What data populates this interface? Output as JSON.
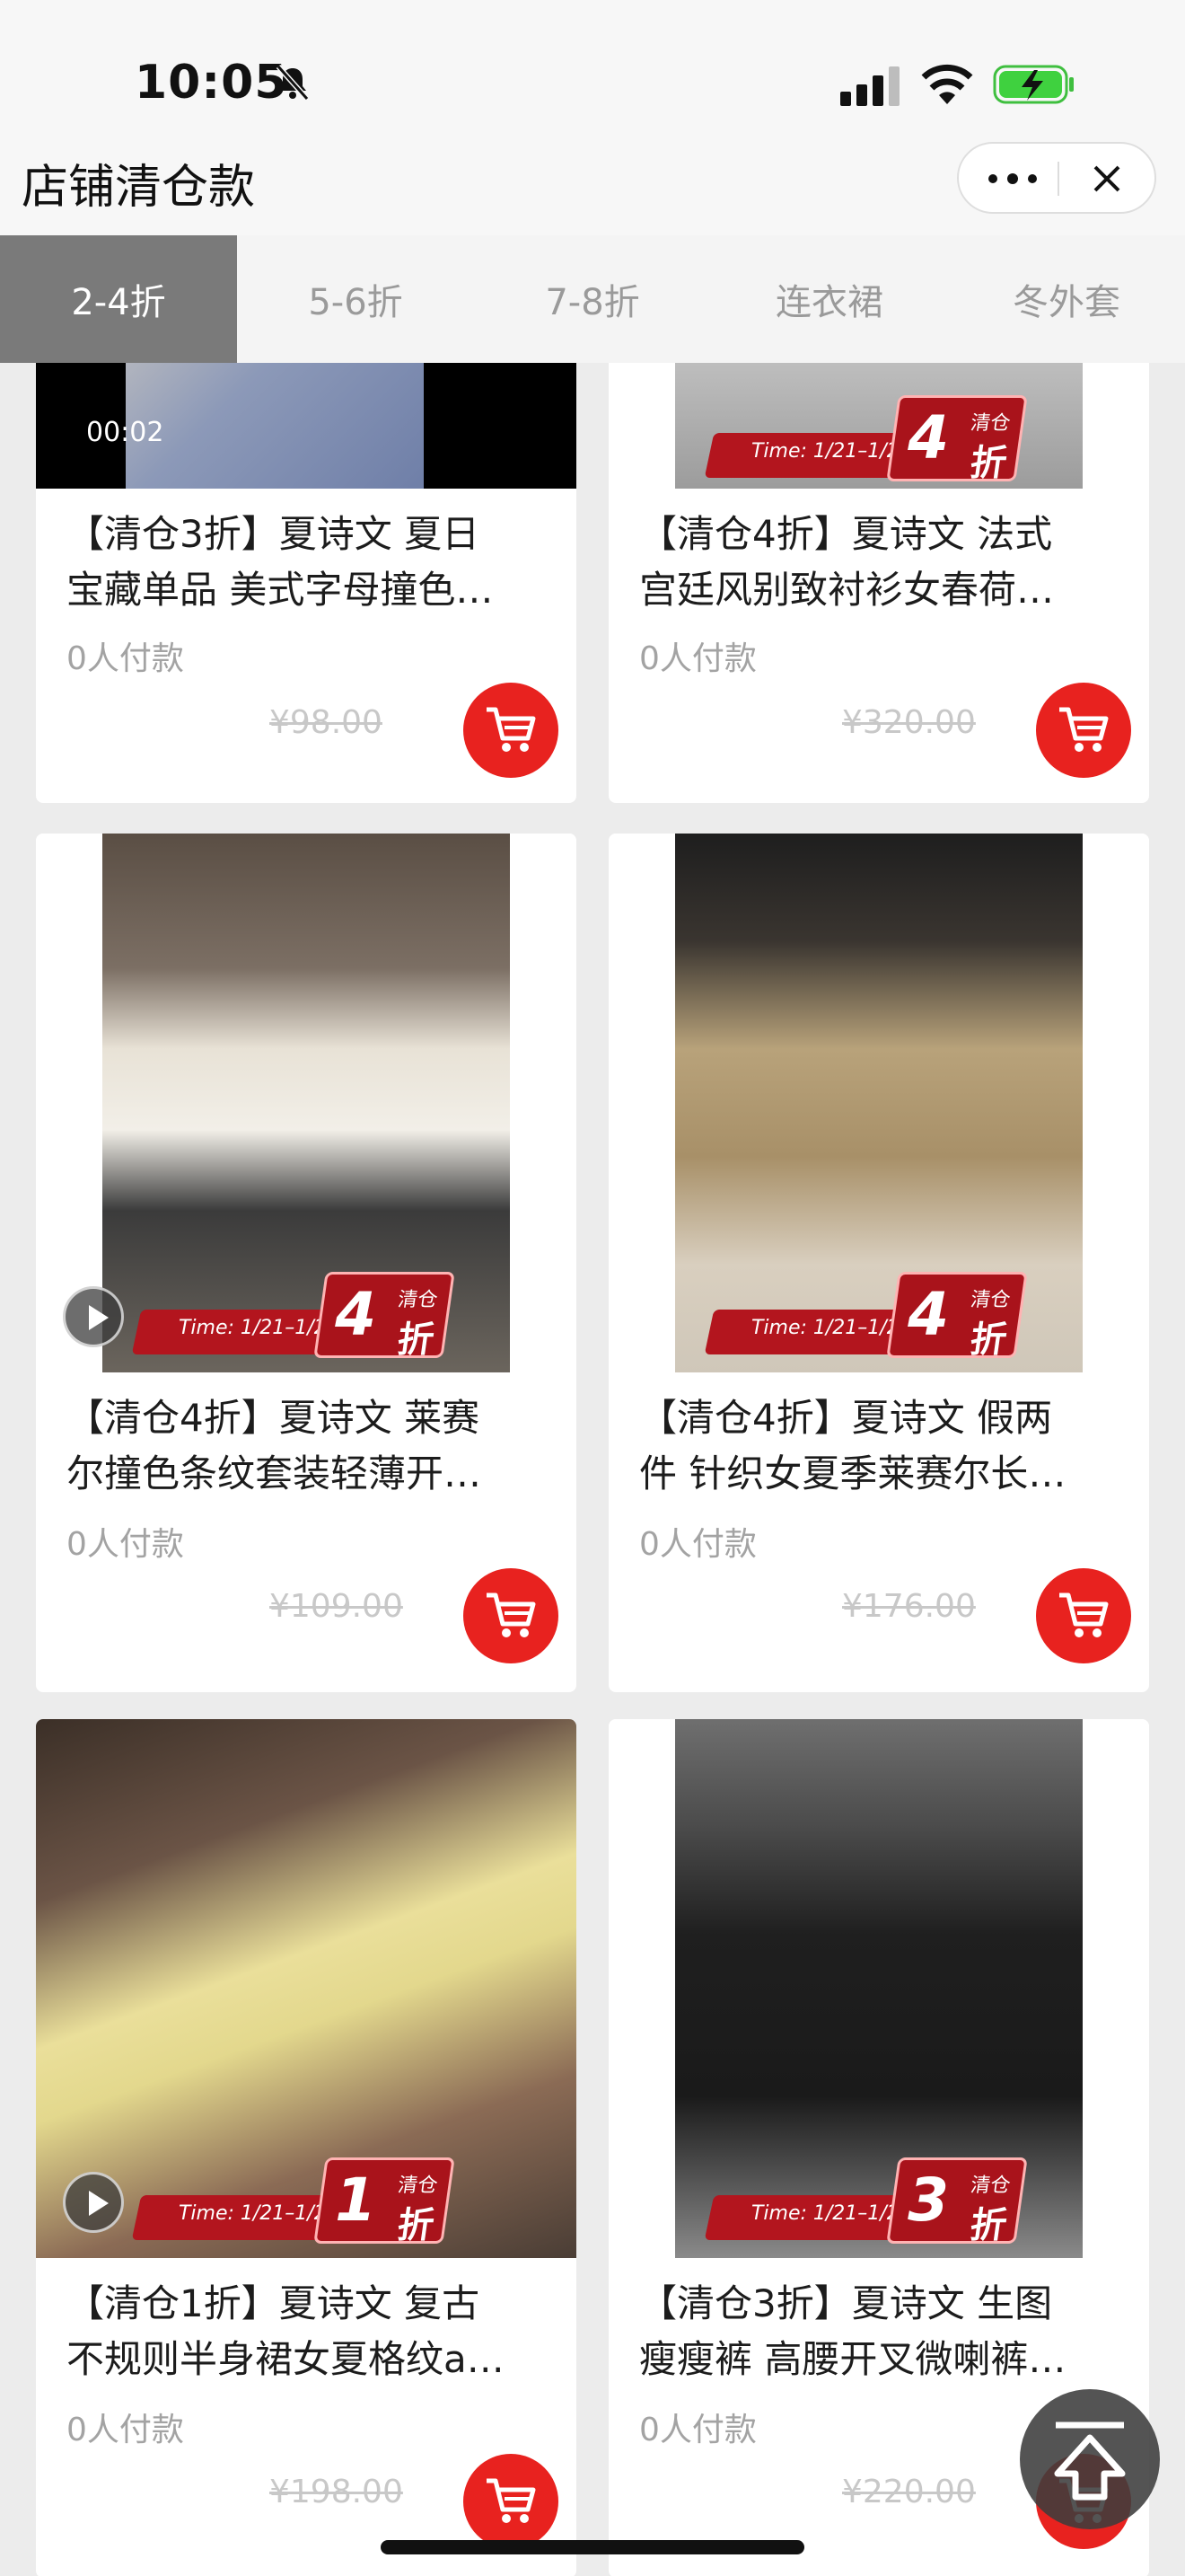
{
  "status_bar": {
    "time": "10:05"
  },
  "header": {
    "title": "店铺清仓款"
  },
  "tabs": [
    {
      "label": "2-4折",
      "active": true
    },
    {
      "label": "5-6折",
      "active": false
    },
    {
      "label": "7-8折",
      "active": false
    },
    {
      "label": "连衣裙",
      "active": false
    },
    {
      "label": "冬外套",
      "active": false
    }
  ],
  "badge": {
    "time_text": "Time: 1/21–1/25",
    "qingcang": "清仓",
    "zhe": "折"
  },
  "products": [
    {
      "title_l1": "【清仓3折】夏诗文 夏日",
      "title_l2": "宝藏单品 美式字母撞色…",
      "sales": "0人付款",
      "price": "¥98.00",
      "video_time": "00:02"
    },
    {
      "title_l1": "【清仓4折】夏诗文 法式",
      "title_l2": "宫廷风别致衬衫女春荷…",
      "sales": "0人付款",
      "price": "¥320.00",
      "discount": "4"
    },
    {
      "title_l1": "【清仓4折】夏诗文 莱赛",
      "title_l2": "尔撞色条纹套装轻薄开…",
      "sales": "0人付款",
      "price": "¥109.00",
      "discount": "4"
    },
    {
      "title_l1": "【清仓4折】夏诗文 假两",
      "title_l2": "件 针织女夏季莱赛尔长…",
      "sales": "0人付款",
      "price": "¥176.00",
      "discount": "4"
    },
    {
      "title_l1": "【清仓1折】夏诗文 复古",
      "title_l2": "不规则半身裙女夏格纹a…",
      "sales": "0人付款",
      "price": "¥198.00",
      "discount": "1"
    },
    {
      "title_l1": "【清仓3折】夏诗文 生图",
      "title_l2": "瘦瘦裤 高腰开叉微喇裤…",
      "sales": "0人付款",
      "price": "¥220.00",
      "discount": "3"
    }
  ],
  "colors": {
    "accent": "#e8221f",
    "badge_red": "#a9131b",
    "tab_active_bg": "#7a7a7a"
  }
}
